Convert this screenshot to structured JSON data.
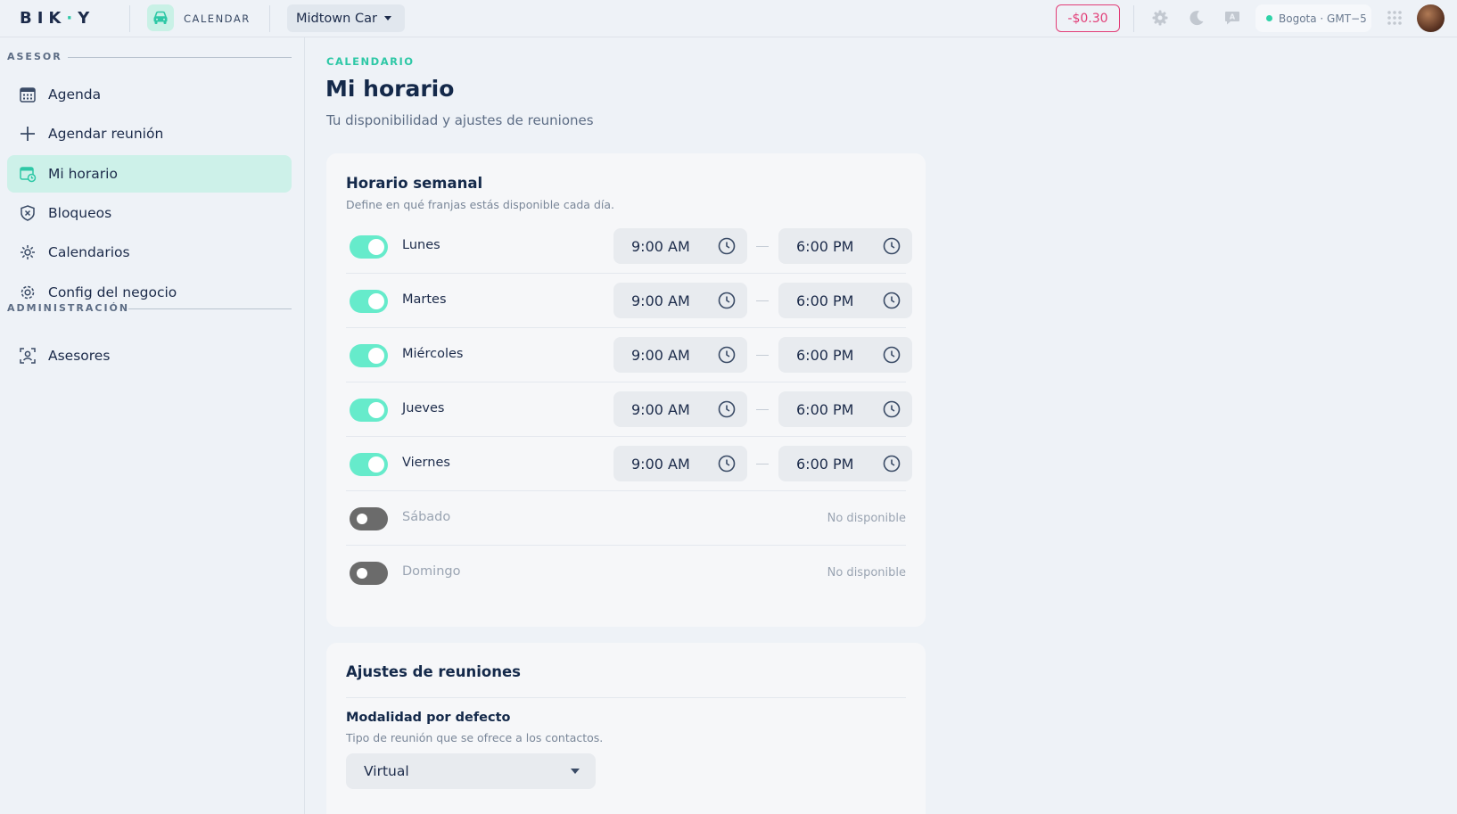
{
  "topbar": {
    "logo": {
      "left": "BI",
      "mid": "K",
      "dot": "·",
      "right": "Y"
    },
    "app_icon": "car-icon",
    "app_name": "CALENDAR",
    "business": "Midtown Car",
    "balance": "-$0.30",
    "icons": [
      "gear-icon",
      "moon-icon",
      "chat-icon",
      "apps-grid-icon"
    ],
    "timezone": "Bogota · GMT−5"
  },
  "sidebar": {
    "section_asesor": "ASESOR",
    "section_admin": "ADMINISTRACIÓN",
    "items": [
      {
        "label": "Agenda",
        "icon": "calendar-icon"
      },
      {
        "label": "Agendar reunión",
        "icon": "plus-icon"
      },
      {
        "label": "Mi horario",
        "icon": "schedule-icon"
      },
      {
        "label": "Bloqueos",
        "icon": "shield-x-icon"
      },
      {
        "label": "Calendarios",
        "icon": "sync-icon"
      },
      {
        "label": "Config del negocio",
        "icon": "gear-icon"
      }
    ],
    "admin_items": [
      {
        "label": "Asesores",
        "icon": "users-icon"
      }
    ]
  },
  "main": {
    "crumb": "CALENDARIO",
    "title": "Mi horario",
    "subtitle": "Tu disponibilidad y ajustes de reuniones",
    "weekly": {
      "title": "Horario semanal",
      "desc": "Define en qué franjas estás disponible cada día.",
      "days": [
        {
          "name": "Lunes",
          "enabled": true,
          "start": "9:00 AM",
          "end": "6:00 PM"
        },
        {
          "name": "Martes",
          "enabled": true,
          "start": "9:00 AM",
          "end": "6:00 PM"
        },
        {
          "name": "Miércoles",
          "enabled": true,
          "start": "9:00 AM",
          "end": "6:00 PM"
        },
        {
          "name": "Jueves",
          "enabled": true,
          "start": "9:00 AM",
          "end": "6:00 PM"
        },
        {
          "name": "Viernes",
          "enabled": true,
          "start": "9:00 AM",
          "end": "6:00 PM"
        },
        {
          "name": "Sábado",
          "enabled": false,
          "status": "No disponible"
        },
        {
          "name": "Domingo",
          "enabled": false,
          "status": "No disponible"
        }
      ]
    },
    "meetings": {
      "title": "Ajustes de reuniones",
      "modality_label": "Modalidad por defecto",
      "modality_desc": "Tipo de reunión que se ofrece a los contactos.",
      "modality_value": "Virtual"
    }
  },
  "colors": {
    "accent": "#2ec8a6",
    "toggle_on": "#66ebcb",
    "danger": "#e23d77",
    "active_nav": "#cdf1e9"
  }
}
